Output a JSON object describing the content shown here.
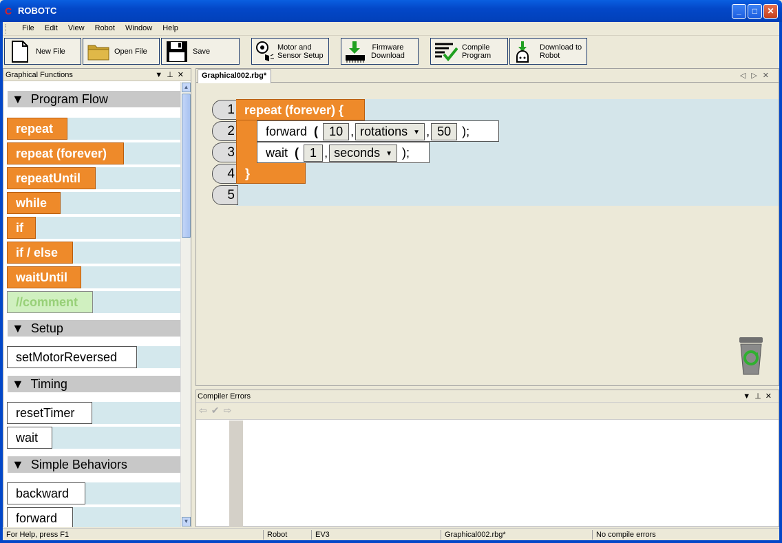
{
  "window": {
    "title": "ROBOTC"
  },
  "menu": [
    "File",
    "Edit",
    "View",
    "Robot",
    "Window",
    "Help"
  ],
  "toolbar": {
    "new_file": "New File",
    "open_file": "Open File",
    "save": "Save",
    "motor_line1": "Motor and",
    "motor_line2": "Sensor Setup",
    "firmware_line1": "Firmware",
    "firmware_line2": "Download",
    "compile_line1": "Compile",
    "compile_line2": "Program",
    "download_line1": "Download to",
    "download_line2": "Robot"
  },
  "palette": {
    "title": "Graphical Functions",
    "sections": {
      "program_flow": "Program Flow",
      "setup": "Setup",
      "timing": "Timing",
      "simple_behaviors": "Simple Behaviors"
    },
    "blocks": {
      "repeat": "repeat",
      "repeat_forever": "repeat (forever)",
      "repeat_until": "repeatUntil",
      "while": "while",
      "if": "if",
      "if_else": "if / else",
      "wait_until": "waitUntil",
      "comment": "//comment",
      "set_motor_reversed": "setMotorReversed",
      "reset_timer": "resetTimer",
      "wait": "wait",
      "backward": "backward",
      "forward": "forward"
    }
  },
  "editor": {
    "tab": "Graphical002.rbg*",
    "line_numbers": [
      "1",
      "2",
      "3",
      "4",
      "5"
    ],
    "line1": "repeat (forever) {",
    "line2": {
      "cmd": "forward",
      "open": "(",
      "arg1": "10",
      "sep1": ",",
      "arg2": "rotations",
      "sep2": ",",
      "arg3": "50",
      "close": ");"
    },
    "line3": {
      "cmd": "wait",
      "open": "(",
      "arg1": "1",
      "sep1": ",",
      "arg2": "seconds",
      "close": ");"
    },
    "line4": "}"
  },
  "compiler": {
    "title": "Compiler Errors"
  },
  "status": {
    "help": "For Help, press F1",
    "robot": "Robot",
    "platform": "EV3",
    "file": "Graphical002.rbg*",
    "compile": "No compile errors"
  }
}
